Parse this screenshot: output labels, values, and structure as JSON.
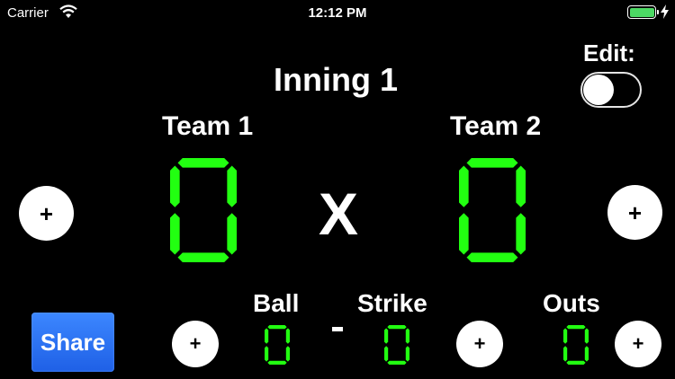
{
  "status_bar": {
    "carrier": "Carrier",
    "time": "12:12 PM",
    "wifi_icon": "wifi-icon",
    "battery_icon": "battery-charging-icon",
    "battery_level": 1.0
  },
  "edit": {
    "label": "Edit:",
    "toggle_on": false
  },
  "inning": {
    "label": "Inning 1"
  },
  "team1": {
    "name": "Team 1",
    "score": 0
  },
  "team2": {
    "name": "Team 2",
    "score": 0
  },
  "versus": "X",
  "count": {
    "ball": {
      "label": "Ball",
      "value": 0
    },
    "strike": {
      "label": "Strike",
      "value": 0
    },
    "outs": {
      "label": "Outs",
      "value": 0
    },
    "separator": "-"
  },
  "buttons": {
    "plus": "+",
    "share": "Share"
  },
  "colors": {
    "digit": "#22ff11",
    "background": "#000000",
    "share": "#2c6ff5"
  }
}
